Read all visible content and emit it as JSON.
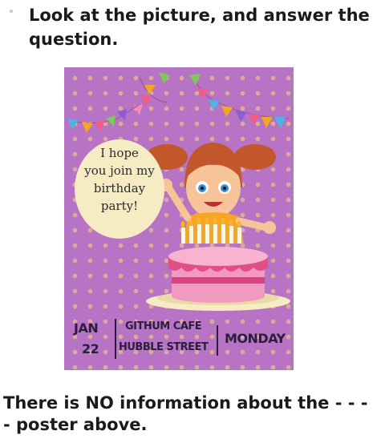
{
  "question": "Look at the picture, and answer the question.",
  "poster": {
    "bubble_lines": [
      "I hope",
      "you join my",
      "birthday",
      "party!"
    ],
    "month": "JAN",
    "day": "22",
    "venue_line1": "GITHUM CAFE",
    "venue_line2": "HUBBLE STREET",
    "weekday": "MONDAY",
    "colors": {
      "background": "#b774c4",
      "cake": "#f19ac0",
      "bubble": "#f6ecc4"
    }
  },
  "statement": "There is NO information about the - - - - poster above."
}
